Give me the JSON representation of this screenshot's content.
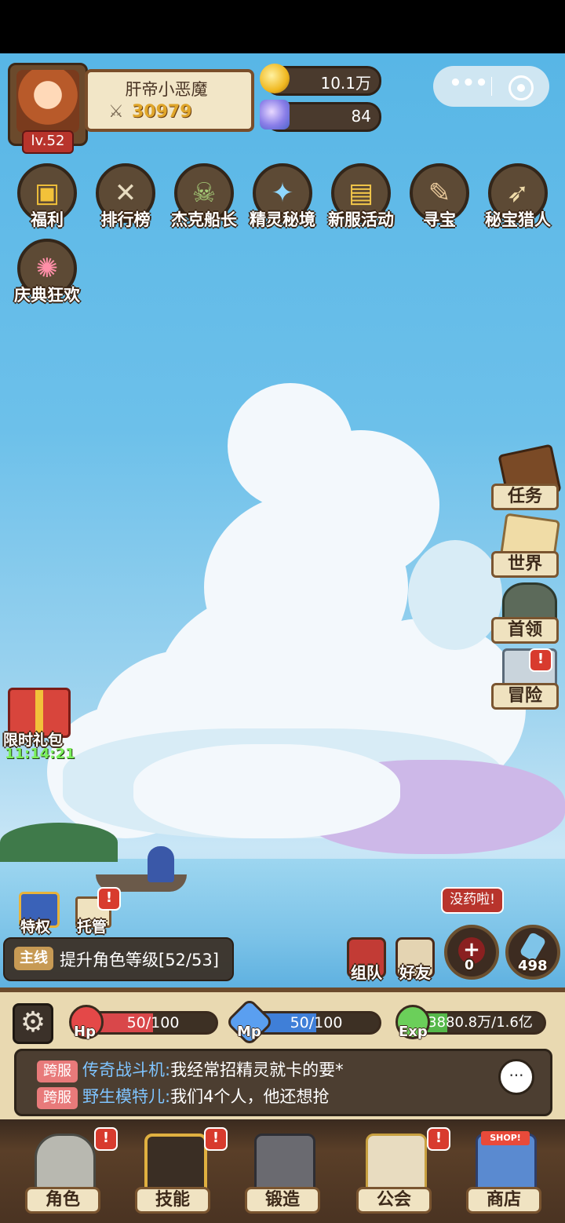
{
  "player": {
    "name": "肝帝小恶魔",
    "power": "30979",
    "level": "lv.52"
  },
  "resources": {
    "gold": "10.1万",
    "diamonds": "84"
  },
  "wechat": {
    "more": "•••"
  },
  "activities": [
    {
      "label": "福利",
      "icon": "treasure-chest-icon"
    },
    {
      "label": "排行榜",
      "icon": "ranking-scroll-icon"
    },
    {
      "label": "杰克船长",
      "icon": "captain-skull-icon"
    },
    {
      "label": "精灵秘境",
      "icon": "spirit-crystal-icon"
    },
    {
      "label": "新服活动",
      "icon": "gift-chest-icon"
    },
    {
      "label": "寻宝",
      "icon": "treasure-map-icon"
    },
    {
      "label": "秘宝猎人",
      "icon": "hunter-map-icon"
    },
    {
      "label": "庆典狂欢",
      "icon": "celebration-horn-icon"
    }
  ],
  "side_menu": [
    {
      "label": "任务",
      "icon": "book-icon"
    },
    {
      "label": "世界",
      "icon": "world-map-icon"
    },
    {
      "label": "首领",
      "icon": "boss-icon"
    },
    {
      "label": "冒险",
      "icon": "adventure-sword-icon",
      "alert": "!"
    }
  ],
  "gift": {
    "label": "限时礼包",
    "timer": "11:14:21"
  },
  "perks": {
    "privilege": "特权",
    "auto": "托管",
    "auto_alert": "!"
  },
  "quest": {
    "tag": "主线",
    "text": "提升角色等级[52/53]"
  },
  "social": {
    "team": "组队",
    "friends": "好友"
  },
  "potions": {
    "warning": "没药啦!",
    "hp_count": "0",
    "mp_count": "498"
  },
  "stats": {
    "hp_label": "Hp",
    "hp": "50/100",
    "hp_fraction": 0.5,
    "mp_label": "Mp",
    "mp": "50/100",
    "mp_fraction": 0.5,
    "exp_label": "Exp",
    "exp": "3880.8万/1.6亿",
    "exp_fraction": 0.24
  },
  "chat": [
    {
      "tag": "跨服",
      "name": "传奇战斗机:",
      "message": "我经常招精灵就卡的要*"
    },
    {
      "tag": "跨服",
      "name": "野生模特儿:",
      "message": "我们4个人，他还想抢"
    }
  ],
  "chat_button": "···",
  "nav": [
    {
      "label": "角色",
      "icon": "knight-helmet-icon",
      "alert": "!"
    },
    {
      "label": "技能",
      "icon": "skill-book-icon",
      "alert": "!"
    },
    {
      "label": "锻造",
      "icon": "anvil-icon"
    },
    {
      "label": "公会",
      "icon": "guild-castle-icon",
      "alert": "!"
    },
    {
      "label": "商店",
      "icon": "shop-stall-icon"
    }
  ],
  "shop_sign": "SHOP!",
  "colors": {
    "sky": "#6cc0ea",
    "hp": "#d9474a",
    "mp": "#3f7fd8",
    "exp": "#55b84a",
    "alert": "#d83b2e"
  }
}
